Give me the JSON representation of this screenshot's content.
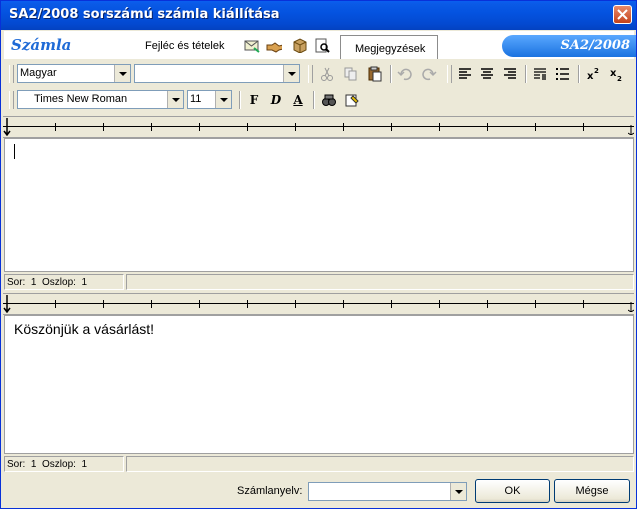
{
  "window": {
    "title": "SA2/2008 sorszámú számla kiállítása"
  },
  "header": {
    "brand": "Számla",
    "tab_header_items": "Fejléc és tételek",
    "tab_notes": "Megjegyzések",
    "document_id": "SA2/2008"
  },
  "toolbar1": {
    "language_value": "Magyar",
    "style_value": ""
  },
  "toolbar2": {
    "font_value": "Times New Roman",
    "size_value": "11",
    "bold": "F",
    "italic": "D",
    "underline": "A"
  },
  "editor1": {
    "content": ""
  },
  "status1": {
    "row_label": "Sor:",
    "row": "1",
    "col_label": "Oszlop:",
    "col": "1"
  },
  "editor2": {
    "content": "Köszönjük a vásárlást!"
  },
  "status2": {
    "row_label": "Sor:",
    "row": "1",
    "col_label": "Oszlop:",
    "col": "1"
  },
  "footer": {
    "language_label": "Számlanyelv:",
    "language_value": "",
    "ok_label": "OK",
    "cancel_label": "Mégse"
  }
}
